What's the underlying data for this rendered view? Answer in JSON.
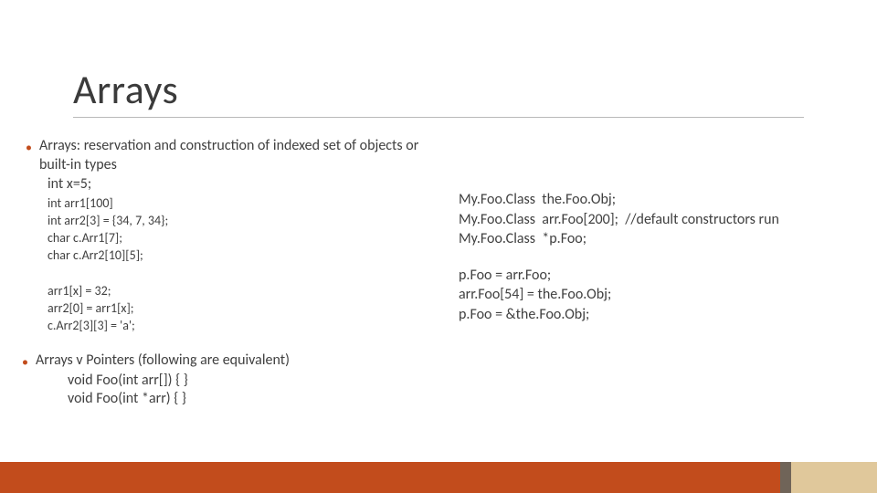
{
  "title": "Arrays",
  "left": {
    "bullet1_prefix": "Arrays:  ",
    "bullet1_rest": "reservation and construction of indexed set of objects or built-in types",
    "line_intx": "int x=5;",
    "code1": [
      "int arr1[100]",
      "int arr2[3] = {34, 7, 34};",
      "char c.Arr1[7];",
      "char c.Arr2[10][5];"
    ],
    "code2": [
      "arr1[x] = 32;",
      "arr2[0] = arr1[x];",
      "c.Arr2[3][3] = 'a';"
    ],
    "bullet2": "Arrays v Pointers (following are equivalent)",
    "eq1": "void Foo(int arr[]) { }",
    "eq2": "void Foo(int *arr) { }"
  },
  "right": {
    "block1": [
      "My.Foo.Class  the.Foo.Obj;",
      "My.Foo.Class  arr.Foo[200];  //default constructors run",
      "My.Foo.Class  *p.Foo;"
    ],
    "block2": [
      "p.Foo = arr.Foo;",
      "arr.Foo[54] = the.Foo.Obj;",
      "p.Foo = &the.Foo.Obj;"
    ]
  },
  "colors": {
    "accent": "#c24c1c",
    "footer_grey": "#706458",
    "footer_tan": "#e0c89b"
  }
}
